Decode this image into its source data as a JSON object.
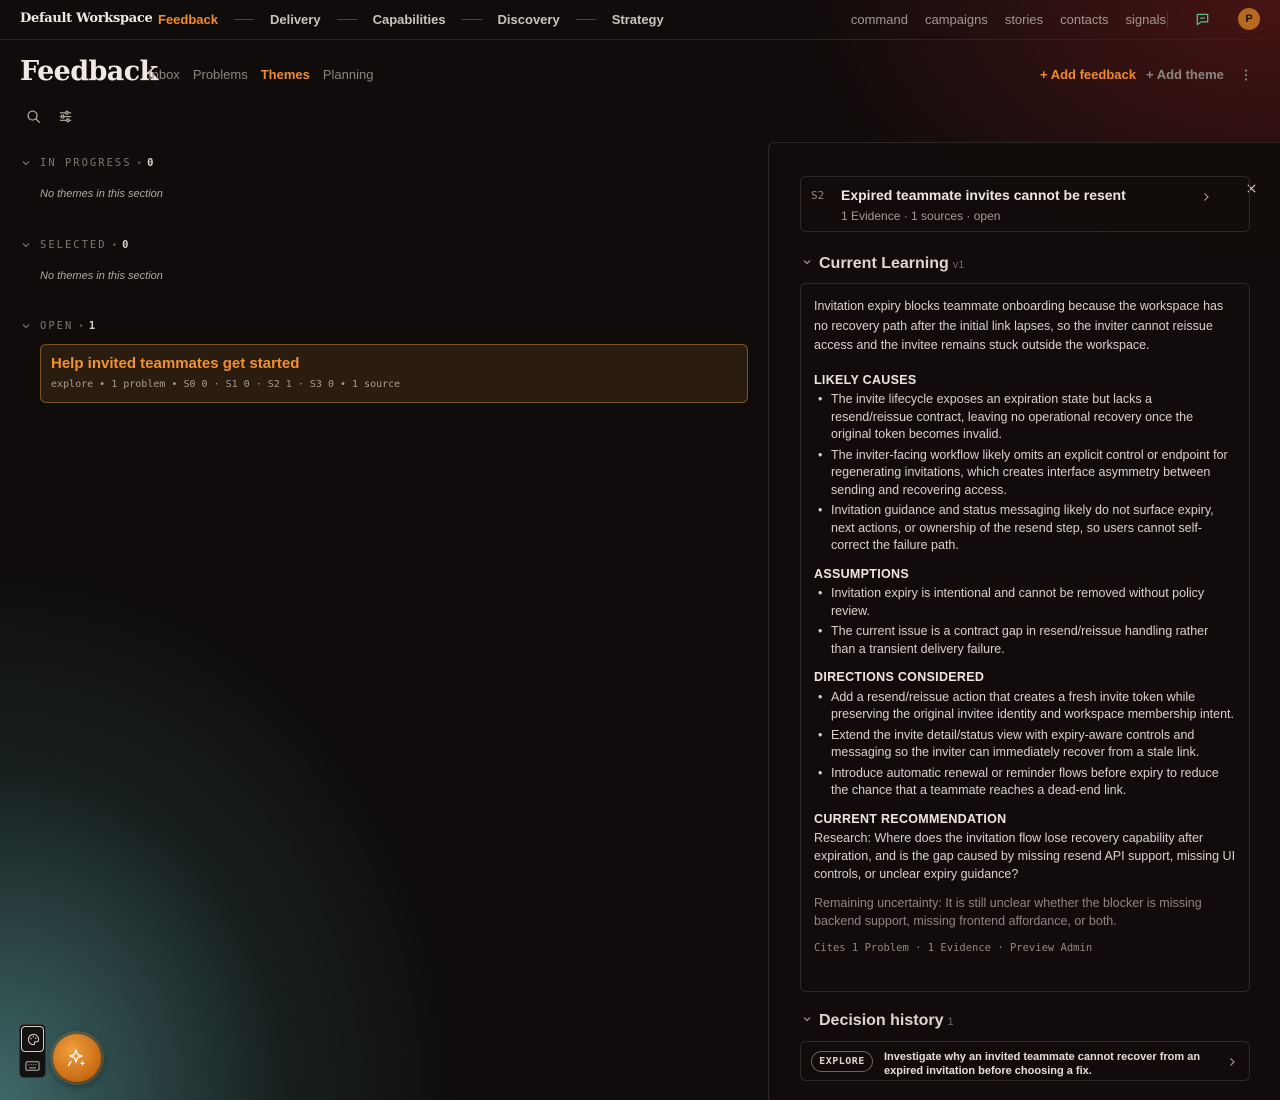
{
  "workspace": "Default Workspace",
  "main_nav": [
    "Feedback",
    "Delivery",
    "Capabilities",
    "Discovery",
    "Strategy"
  ],
  "sub_nav": [
    "command",
    "campaigns",
    "stories",
    "contacts",
    "signals"
  ],
  "avatar_initial": "P",
  "page": {
    "title": "Feedback",
    "tabs": [
      "Inbox",
      "Problems",
      "Themes",
      "Planning"
    ],
    "active_tab": "Themes",
    "add_feedback": "+ Add feedback",
    "add_theme": "+ Add theme"
  },
  "sections": {
    "in_progress": {
      "title": "IN PROGRESS",
      "count": "0",
      "empty": "No themes in this section"
    },
    "selected": {
      "title": "SELECTED",
      "count": "0",
      "empty": "No themes in this section"
    },
    "open": {
      "title": "OPEN",
      "count": "1",
      "theme": {
        "title": "Help invited teammates get started",
        "meta": "explore • 1 problem • S0 0 · S1 0 · S2 1 · S3 0 • 1 source"
      }
    }
  },
  "panel": {
    "problem": {
      "severity": "S2",
      "title": "Expired teammate invites cannot be resent",
      "meta": "1 Evidence · 1 sources · open"
    },
    "learning": {
      "heading": "Current Learning",
      "version": "v1",
      "intro": "Invitation expiry blocks teammate onboarding because the workspace has no recovery path after the initial link lapses, so the inviter cannot reissue access and the invitee remains stuck outside the workspace.",
      "likely_causes_title": "LIKELY CAUSES",
      "likely_causes": [
        "The invite lifecycle exposes an expiration state but lacks a resend/reissue contract, leaving no operational recovery once the original token becomes invalid.",
        "The inviter-facing workflow likely omits an explicit control or endpoint for regenerating invitations, which creates interface asymmetry between sending and recovering access.",
        "Invitation guidance and status messaging likely do not surface expiry, next actions, or ownership of the resend step, so users cannot self-correct the failure path."
      ],
      "assumptions_title": "ASSUMPTIONS",
      "assumptions": [
        "Invitation expiry is intentional and cannot be removed without policy review.",
        "The current issue is a contract gap in resend/reissue handling rather than a transient delivery failure."
      ],
      "directions_title": "DIRECTIONS CONSIDERED",
      "directions": [
        "Add a resend/reissue action that creates a fresh invite token while preserving the original invitee identity and workspace membership intent.",
        "Extend the invite detail/status view with expiry-aware controls and messaging so the inviter can immediately recover from a stale link.",
        "Introduce automatic renewal or reminder flows before expiry to reduce the chance that a teammate reaches a dead-end link."
      ],
      "recommendation_title": "CURRENT RECOMMENDATION",
      "recommendation": "Research: Where does the invitation flow lose recovery capability after expiration, and is the gap caused by missing resend API support, missing UI controls, or unclear expiry guidance?",
      "uncertainty": "Remaining uncertainty: It is still unclear whether the blocker is missing backend support, missing frontend affordance, or both.",
      "cites": "Cites 1 Problem · 1 Evidence · Preview Admin"
    },
    "decision": {
      "heading": "Decision history",
      "count": "1",
      "badge": "EXPLORE",
      "text": "Investigate why an invited teammate cannot recover from an expired invitation before choosing a fix."
    }
  },
  "colors": {
    "accent": "#f08a2c",
    "background": "#0f0c0b"
  }
}
